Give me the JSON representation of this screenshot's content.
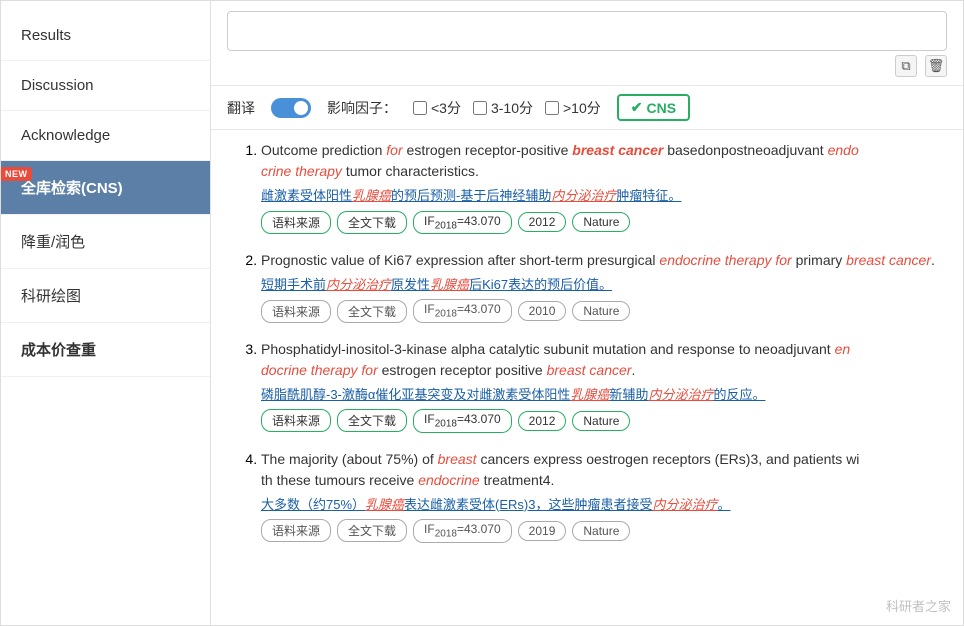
{
  "sidebar": {
    "items": [
      {
        "id": "results",
        "label": "Results",
        "active": false,
        "new": false,
        "bold": false
      },
      {
        "id": "discussion",
        "label": "Discussion",
        "active": false,
        "new": false,
        "bold": false
      },
      {
        "id": "acknowledge",
        "label": "Acknowledge",
        "active": false,
        "new": false,
        "bold": false
      },
      {
        "id": "quanku",
        "label": "全库检索(CNS)",
        "active": true,
        "new": true,
        "bold": false
      },
      {
        "id": "jiangchong",
        "label": "降重/润色",
        "active": false,
        "new": false,
        "bold": false
      },
      {
        "id": "kehui",
        "label": "科研绘图",
        "active": false,
        "new": false,
        "bold": false
      },
      {
        "id": "chengben",
        "label": "成本价查重",
        "active": false,
        "new": false,
        "bold": true
      }
    ]
  },
  "filter": {
    "translate_label": "翻译",
    "if_label": "影响因子：",
    "option1": "<3分",
    "option2": "3-10分",
    "option3": ">10分",
    "cns_label": "CNS"
  },
  "results": [
    {
      "id": 1,
      "title_parts": [
        {
          "text": "Outcome prediction ",
          "style": "normal"
        },
        {
          "text": "for",
          "style": "italic-red"
        },
        {
          "text": " estrogen receptor-positive ",
          "style": "normal"
        },
        {
          "text": "breast cancer",
          "style": "italic-red-bold"
        },
        {
          "text": " basedonpostneoadjuvant ",
          "style": "normal"
        },
        {
          "text": "endocrine therapy",
          "style": "italic-red"
        },
        {
          "text": " tumor characteristics.",
          "style": "normal"
        }
      ],
      "title_text": "Outcome prediction for estrogen receptor-positive breast cancer basedonpostneoadjuvant endocrine therapy tumor characteristics.",
      "cn_text": "雌激素受体阳性乳腺癌的预后预测-基于后辅助内分泌治疗肿瘤特征。",
      "tags": [
        "语料来源",
        "全文下载",
        "IF2018=43.070",
        "2012",
        "Nature"
      ],
      "green": true
    },
    {
      "id": 2,
      "title_text": "Prognostic value of Ki67 expression after short-term presurgical endocrine therapy for primary breast cancer.",
      "cn_text": "短期手术前内分泌治疗原发性乳腺癌后Ki67表达的预后价值。",
      "tags": [
        "语料来源",
        "全文下载",
        "IF2018=43.070",
        "2010",
        "Nature"
      ],
      "green": false
    },
    {
      "id": 3,
      "title_text": "Phosphatidyl-inositol-3-kinase alpha catalytic subunit mutation and response to neoadjuvant endocrine therapy for estrogen receptor positive breast cancer.",
      "cn_text": "磷脂酰肌醇-3-激酶α催化亚基突变及对雌激素受体阳性乳腺癌新辅助内分泌治疗的反应。",
      "tags": [
        "语料来源",
        "全文下载",
        "IF2018=43.070",
        "2012",
        "Nature"
      ],
      "green": true
    },
    {
      "id": 4,
      "title_text": "The majority (about 75%) of breast cancers express oestrogen receptors (ERs)3, and patients with these tumours receive endocrine treatment4.",
      "cn_text": "大多数（约75%）乳腺癌表达雌激素受体(ERs)3，这些肿瘤患者接受内分泌治疗。",
      "tags": [
        "语料来源",
        "全文下载",
        "IF2018=43.070",
        "2019",
        "Nature"
      ],
      "green": false
    }
  ],
  "watermark": "科研者之家"
}
